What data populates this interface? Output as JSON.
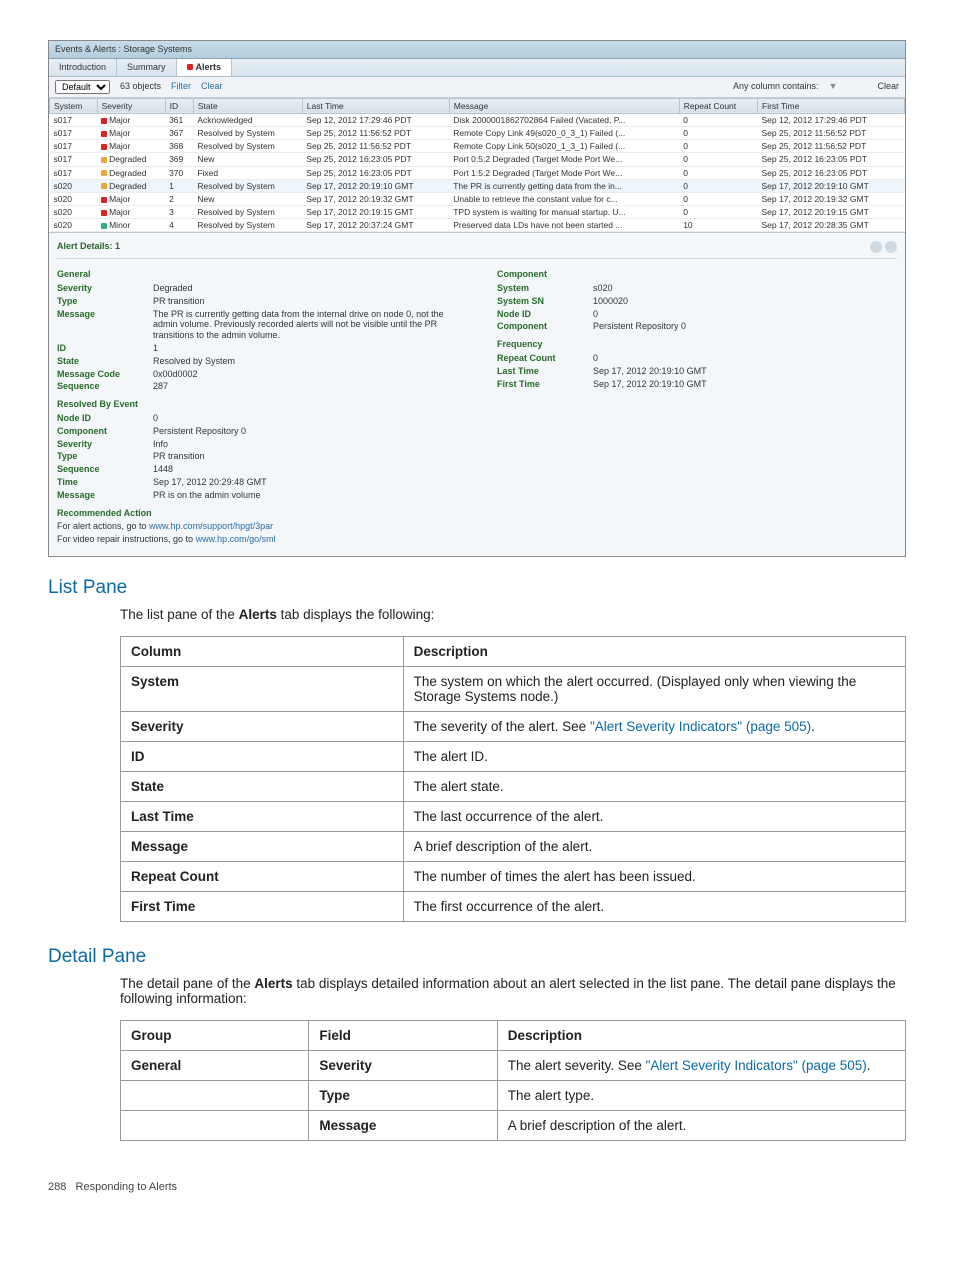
{
  "screenshot": {
    "window_title": "Events & Alerts : Storage Systems",
    "tabs": [
      "Introduction",
      "Summary",
      "Alerts"
    ],
    "active_tab": "Alerts",
    "toolbar": {
      "filter_dropdown": "Default",
      "objects_label": "63 objects",
      "filter_label": "Filter",
      "clear_label": "Clear",
      "contains_label": "Any column contains:",
      "clear_right": "Clear"
    },
    "columns": [
      "System",
      "Severity",
      "ID",
      "State",
      "Last Time",
      "Message",
      "Repeat Count",
      "First Time"
    ],
    "rows": [
      {
        "system": "s017",
        "severity": "Major",
        "sevclass": "sev-major",
        "id": "361",
        "state": "Acknowledged",
        "last": "Sep 12, 2012 17:29:46 PDT",
        "msg": "Disk 2000001862702864 Failed (Vacated, P...",
        "repeat": "0",
        "first": "Sep 12, 2012 17:29:46 PDT"
      },
      {
        "system": "s017",
        "severity": "Major",
        "sevclass": "sev-major",
        "id": "367",
        "state": "Resolved by System",
        "last": "Sep 25, 2012 11:56:52 PDT",
        "msg": "Remote Copy Link 49(s020_0_3_1) Failed (...",
        "repeat": "0",
        "first": "Sep 25, 2012 11:56:52 PDT"
      },
      {
        "system": "s017",
        "severity": "Major",
        "sevclass": "sev-major",
        "id": "368",
        "state": "Resolved by System",
        "last": "Sep 25, 2012 11:56:52 PDT",
        "msg": "Remote Copy Link 50(s020_1_3_1) Failed (...",
        "repeat": "0",
        "first": "Sep 25, 2012 11:56:52 PDT"
      },
      {
        "system": "s017",
        "severity": "Degraded",
        "sevclass": "sev-degraded",
        "id": "369",
        "state": "New",
        "last": "Sep 25, 2012 16:23:05 PDT",
        "msg": "Port 0:5:2 Degraded (Target Mode Port We...",
        "repeat": "0",
        "first": "Sep 25, 2012 16:23:05 PDT"
      },
      {
        "system": "s017",
        "severity": "Degraded",
        "sevclass": "sev-degraded",
        "id": "370",
        "state": "Fixed",
        "last": "Sep 25, 2012 16:23:05 PDT",
        "msg": "Port 1:5:2 Degraded (Target Mode Port We...",
        "repeat": "0",
        "first": "Sep 25, 2012 16:23:05 PDT"
      },
      {
        "system": "s020",
        "severity": "Degraded",
        "sevclass": "sev-degraded",
        "id": "1",
        "state": "Resolved by System",
        "last": "Sep 17, 2012 20:19:10 GMT",
        "msg": "The PR is currently getting data from the in...",
        "repeat": "0",
        "first": "Sep 17, 2012 20:19:10 GMT",
        "hl": true
      },
      {
        "system": "s020",
        "severity": "Major",
        "sevclass": "sev-major",
        "id": "2",
        "state": "New",
        "last": "Sep 17, 2012 20:19:32 GMT",
        "msg": "Unable to retrieve the constant value for c...",
        "repeat": "0",
        "first": "Sep 17, 2012 20:19:32 GMT"
      },
      {
        "system": "s020",
        "severity": "Major",
        "sevclass": "sev-major",
        "id": "3",
        "state": "Resolved by System",
        "last": "Sep 17, 2012 20:19:15 GMT",
        "msg": "TPD system is waiting for manual startup. U...",
        "repeat": "0",
        "first": "Sep 17, 2012 20:19:15 GMT"
      },
      {
        "system": "s020",
        "severity": "Minor",
        "sevclass": "sev-minor",
        "id": "4",
        "state": "Resolved by System",
        "last": "Sep 17, 2012 20:37:24 GMT",
        "msg": "Preserved data LDs have not been started ...",
        "repeat": "10",
        "first": "Sep 17, 2012 20:28:35 GMT"
      }
    ],
    "details": {
      "header": "Alert Details: 1",
      "general_label": "General",
      "component_label": "Component",
      "frequency_label": "Frequency",
      "general": {
        "Severity": "Degraded",
        "Type": "PR transition",
        "Message": "The PR is currently getting data from the internal drive on node 0, not the admin volume. Previously recorded alerts will not be visible until the PR transitions to the admin volume.",
        "ID": "1",
        "State": "Resolved by System",
        "Message Code": "0x00d0002",
        "Sequence": "287"
      },
      "component": {
        "System": "s020",
        "System SN": "1000020",
        "Node ID": "0",
        "Component": "Persistent Repository 0"
      },
      "frequency": {
        "Repeat Count": "0",
        "Last Time": "Sep 17, 2012 20:19:10 GMT",
        "First Time": "Sep 17, 2012 20:19:10 GMT"
      },
      "resolved_label": "Resolved By Event",
      "resolved": {
        "Node ID": "0",
        "Component": "Persistent Repository 0",
        "Severity": "Info",
        "Type": "PR transition",
        "Sequence": "1448",
        "Time": "Sep 17, 2012 20:29:48 GMT",
        "Message": "PR is on the admin volume"
      },
      "recommended_label": "Recommended Action",
      "recommended": {
        "line1_pre": "For alert actions, go to ",
        "line1_link": "www.hp.com/support/hpgt/3par",
        "line2_pre": "For video repair instructions, go to ",
        "line2_link": "www.hp.com/go/sml"
      }
    }
  },
  "listpane": {
    "title": "List Pane",
    "intro_pre": "The list pane of the ",
    "intro_bold": "Alerts",
    "intro_post": " tab displays the following:",
    "headers": {
      "col": "Column",
      "desc": "Description"
    },
    "rows": [
      {
        "col": "System",
        "desc": "The system on which the alert occurred. (Displayed only when viewing the Storage Systems node.)"
      },
      {
        "col": "Severity",
        "desc_pre": "The severity of the alert. See ",
        "desc_link": "\"Alert Severity Indicators\" (page 505)",
        "desc_post": "."
      },
      {
        "col": "ID",
        "desc": "The alert ID."
      },
      {
        "col": "State",
        "desc": "The alert state."
      },
      {
        "col": "Last Time",
        "desc": "The last occurrence of the alert."
      },
      {
        "col": "Message",
        "desc": "A brief description of the alert."
      },
      {
        "col": "Repeat Count",
        "desc": "The number of times the alert has been issued."
      },
      {
        "col": "First Time",
        "desc": "The first occurrence of the alert."
      }
    ]
  },
  "detailpane": {
    "title": "Detail Pane",
    "intro_pre": "The detail pane of the ",
    "intro_bold": "Alerts",
    "intro_post": " tab displays detailed information about an alert selected in the list pane. The detail pane displays the following information:",
    "headers": {
      "group": "Group",
      "field": "Field",
      "desc": "Description"
    },
    "rows": [
      {
        "group": "General",
        "field": "Severity",
        "desc_pre": "The alert severity. See ",
        "desc_link": "\"Alert Severity Indicators\" (page 505)",
        "desc_post": "."
      },
      {
        "group": "",
        "field": "Type",
        "desc": "The alert type."
      },
      {
        "group": "",
        "field": "Message",
        "desc": "A brief description of the alert."
      }
    ]
  },
  "footer": {
    "page": "288",
    "label": "Responding to Alerts"
  }
}
